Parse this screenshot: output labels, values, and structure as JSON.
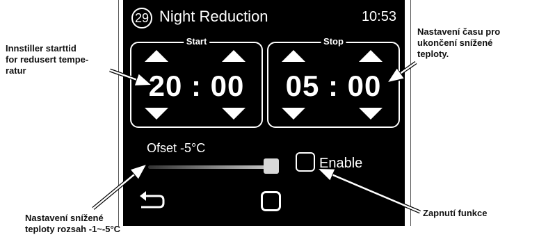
{
  "screen": {
    "badge_number": "29",
    "title": "Night Reduction",
    "time": "10:53",
    "start": {
      "label": "Start",
      "value": "20 : 00"
    },
    "stop": {
      "label": "Stop",
      "value": "05 : 00"
    },
    "offset": {
      "label": "Ofset -5°C",
      "level_fraction": 1.0
    },
    "enable_label": "Enable",
    "enable_checked": false
  },
  "annotations": {
    "start_note": [
      "Innstiller starttid",
      "for redusert tempe-",
      "ratur"
    ],
    "stop_note": [
      "Nastavení času pro",
      "ukončení snížené",
      "teploty."
    ],
    "offset_note": [
      "Nastavení snížené",
      "teploty rozsah -1~-5°C"
    ],
    "enable_note": "Zapnutí funkce"
  },
  "icons": [
    "arrow-up-icon",
    "arrow-down-icon",
    "back-arrow-icon",
    "home-square-icon"
  ],
  "colors": {
    "screen_bg": "#000000",
    "text": "#ffffff",
    "knob": "#d8d8d8"
  }
}
